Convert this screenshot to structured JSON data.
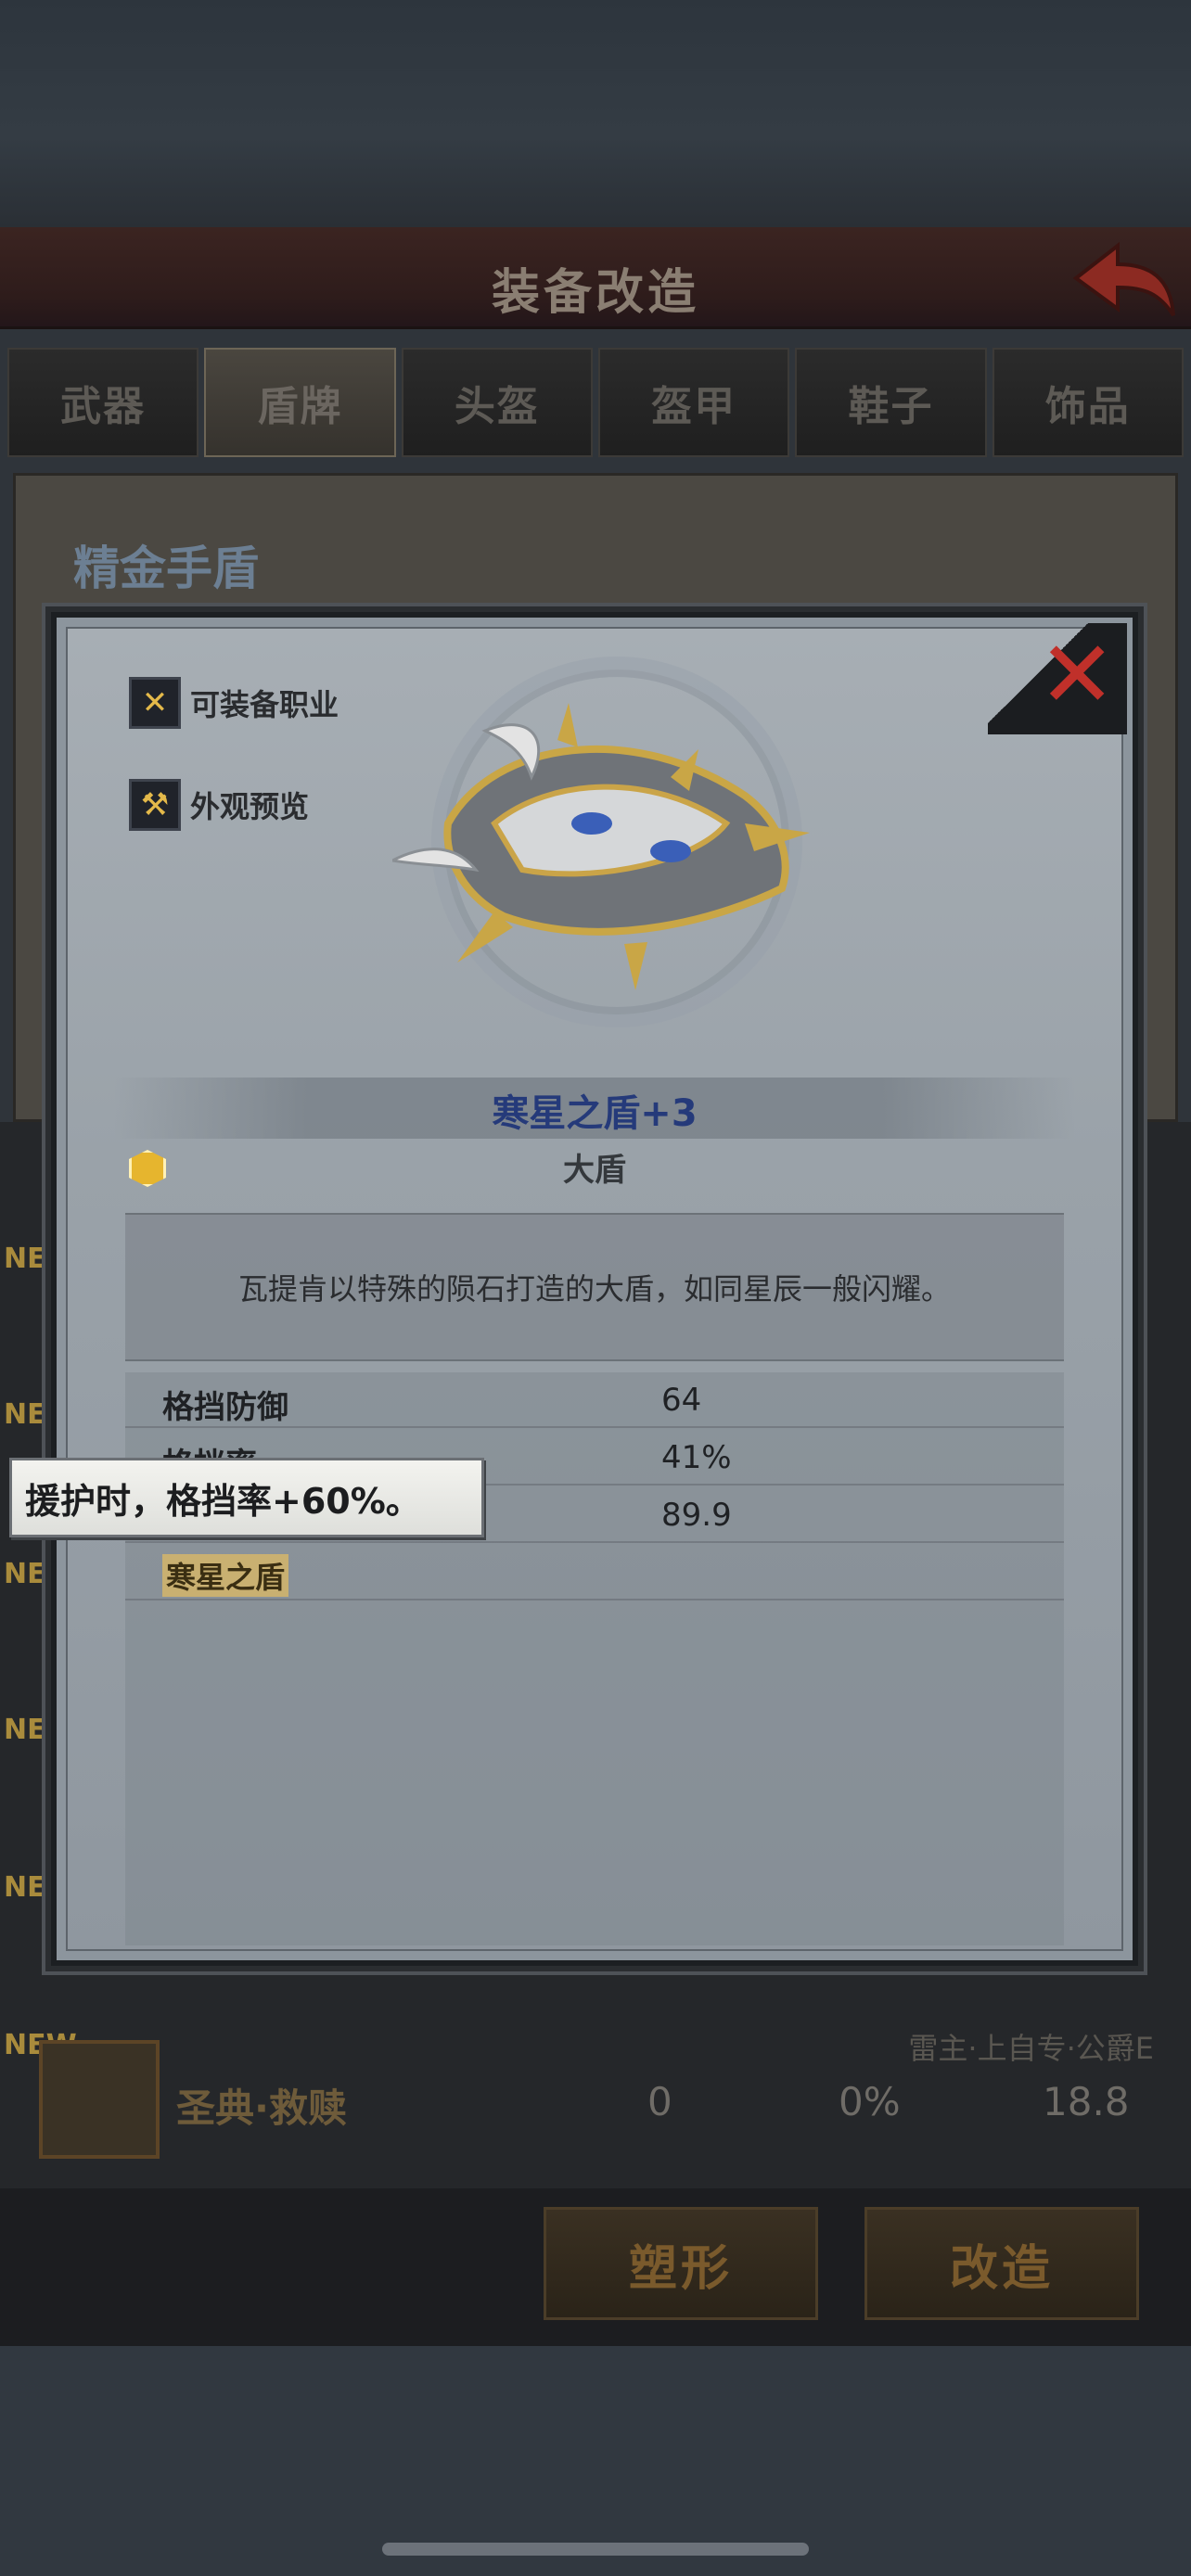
{
  "header": {
    "title": "装备改造"
  },
  "tabs": [
    {
      "label": "武器"
    },
    {
      "label": "盾牌"
    },
    {
      "label": "头盔"
    },
    {
      "label": "盔甲"
    },
    {
      "label": "鞋子"
    },
    {
      "label": "饰品"
    }
  ],
  "background_panel": {
    "item_name": "精金手盾"
  },
  "list": {
    "new_tag": "NEW",
    "last_row": {
      "name": "圣典·救赎",
      "values": [
        "0",
        "0%",
        "18.8"
      ],
      "tags": "雷主·上自专·公爵E"
    }
  },
  "buttons": {
    "reshape": "塑形",
    "modify": "改造"
  },
  "modal": {
    "side_buttons": {
      "equippable_classes": "可装备职业",
      "appearance_preview": "外观预览"
    },
    "item": {
      "title": "寒星之盾+3",
      "type": "大盾",
      "description": "瓦提肯以特殊的陨石打造的大盾，如同星辰一般闪耀。"
    },
    "stats": [
      {
        "label": "格挡防御",
        "value": "64"
      },
      {
        "label": "格挡率",
        "value": "41%"
      },
      {
        "label": "",
        "value": "89.9"
      }
    ],
    "skill": "寒星之盾"
  },
  "tooltip": {
    "text": "援护时，格挡率+60%。"
  },
  "colors": {
    "accent_red": "#c0302a",
    "title_blue": "#253a7a",
    "gold": "#e6b52e"
  }
}
